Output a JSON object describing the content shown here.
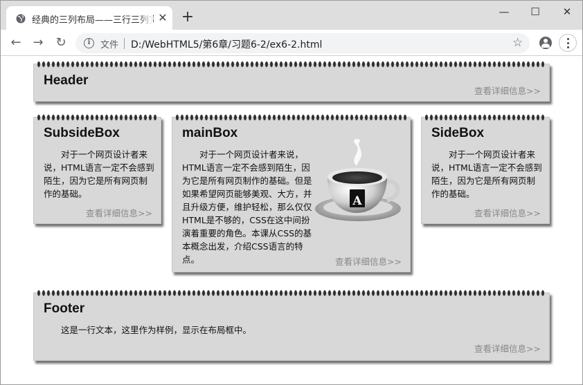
{
  "browser": {
    "tab": {
      "title": "经典的三列布局——三行三列宽度"
    },
    "new_tab_label": "+",
    "window_controls": {
      "minimize": "—",
      "maximize": "☐",
      "close": "✕"
    },
    "toolbar": {
      "back": "←",
      "forward": "→",
      "reload": "↻",
      "file_label": "文件",
      "url": "D:/WebHTML5/第6章/习题6-2/ex6-2.html",
      "star": "☆"
    }
  },
  "page": {
    "header": {
      "title": "Header",
      "more_link": "查看详细信息>>"
    },
    "subside_box": {
      "title": "SubsideBox",
      "text": "对于一个网页设计者来说，HTML语言一定不会感到陌生，因为它是所有网页制作的基础。",
      "more_link": "查看详细信息>>"
    },
    "main_box": {
      "title": "mainBox",
      "text": "对于一个网页设计者来说，HTML语言一定不会感到陌生，因为它是所有网页制作的基础。但是如果希望网页能够美观、大方，并且升级方便，维护轻松，那么仅仅HTML是不够的，CSS在这中间扮演着重要的角色。本课从CSS的基本概念出发，介绍CSS语言的特点。",
      "cup_badge_letter": "A",
      "more_link": "查看详细信息>>"
    },
    "side_box": {
      "title": "SideBox",
      "text": "对于一个网页设计者来说，HTML语言一定不会感到陌生，因为它是所有网页制作的基础。",
      "more_link": "查看详细信息>>"
    },
    "footer": {
      "title": "Footer",
      "text": "这是一行文本，这里作为样例，显示在布局框中。",
      "more_link": "查看详细信息>>"
    }
  },
  "icons": {
    "tab_favicon": "globe-icon",
    "info": "info-icon",
    "account": "account-icon",
    "menu": "more-vert-icon"
  }
}
